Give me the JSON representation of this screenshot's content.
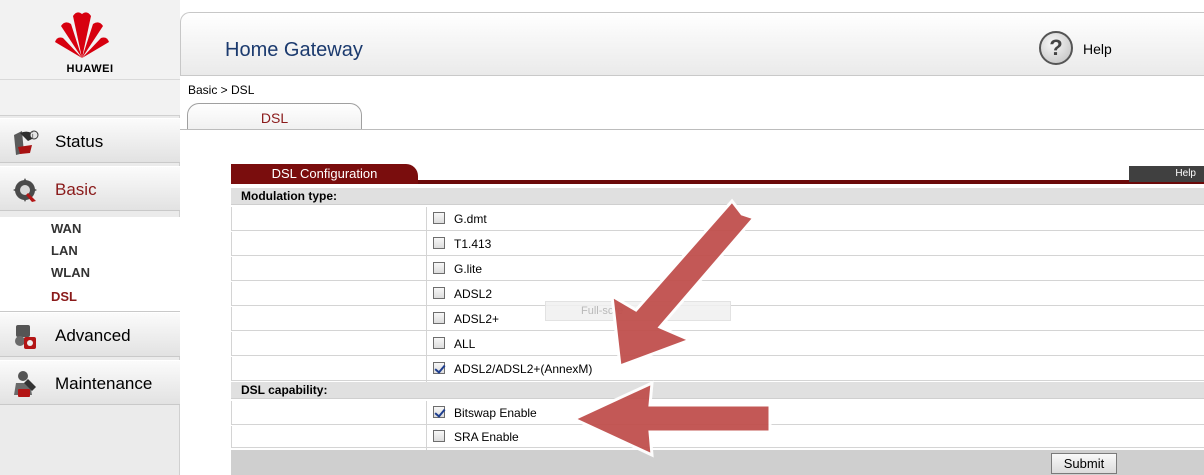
{
  "brand": {
    "name": "HUAWEI"
  },
  "header": {
    "title": "Home Gateway",
    "help_label": "Help"
  },
  "breadcrumb": "Basic > DSL",
  "tabs": [
    {
      "label": "DSL"
    }
  ],
  "sidebar": {
    "items": [
      {
        "label": "Status",
        "icon": "status-icon"
      },
      {
        "label": "Basic",
        "icon": "basic-icon"
      },
      {
        "label": "Advanced",
        "icon": "advanced-icon"
      },
      {
        "label": "Maintenance",
        "icon": "maintenance-icon"
      }
    ],
    "sub_items": [
      {
        "label": "WAN"
      },
      {
        "label": "LAN"
      },
      {
        "label": "WLAN"
      },
      {
        "label": "DSL"
      }
    ]
  },
  "panel": {
    "title": "DSL Configuration",
    "help_label": "Help",
    "modulation": {
      "label": "Modulation type:",
      "options": [
        {
          "label": "G.dmt",
          "checked": false
        },
        {
          "label": "T1.413",
          "checked": false
        },
        {
          "label": "G.lite",
          "checked": false
        },
        {
          "label": "ADSL2",
          "checked": false
        },
        {
          "label": "ADSL2+",
          "checked": false
        },
        {
          "label": "ALL",
          "checked": false
        },
        {
          "label": "ADSL2/ADSL2+(AnnexM)",
          "checked": true
        }
      ]
    },
    "capability": {
      "label": "DSL capability:",
      "options": [
        {
          "label": "Bitswap Enable",
          "checked": true
        },
        {
          "label": "SRA Enable",
          "checked": false
        }
      ]
    },
    "submit_label": "Submit"
  },
  "overlay": {
    "fullscreen_text": "Full-scre"
  },
  "colors": {
    "accent": "#7a0d0d",
    "title": "#1b3a6e",
    "arrow": "#c0504d"
  }
}
